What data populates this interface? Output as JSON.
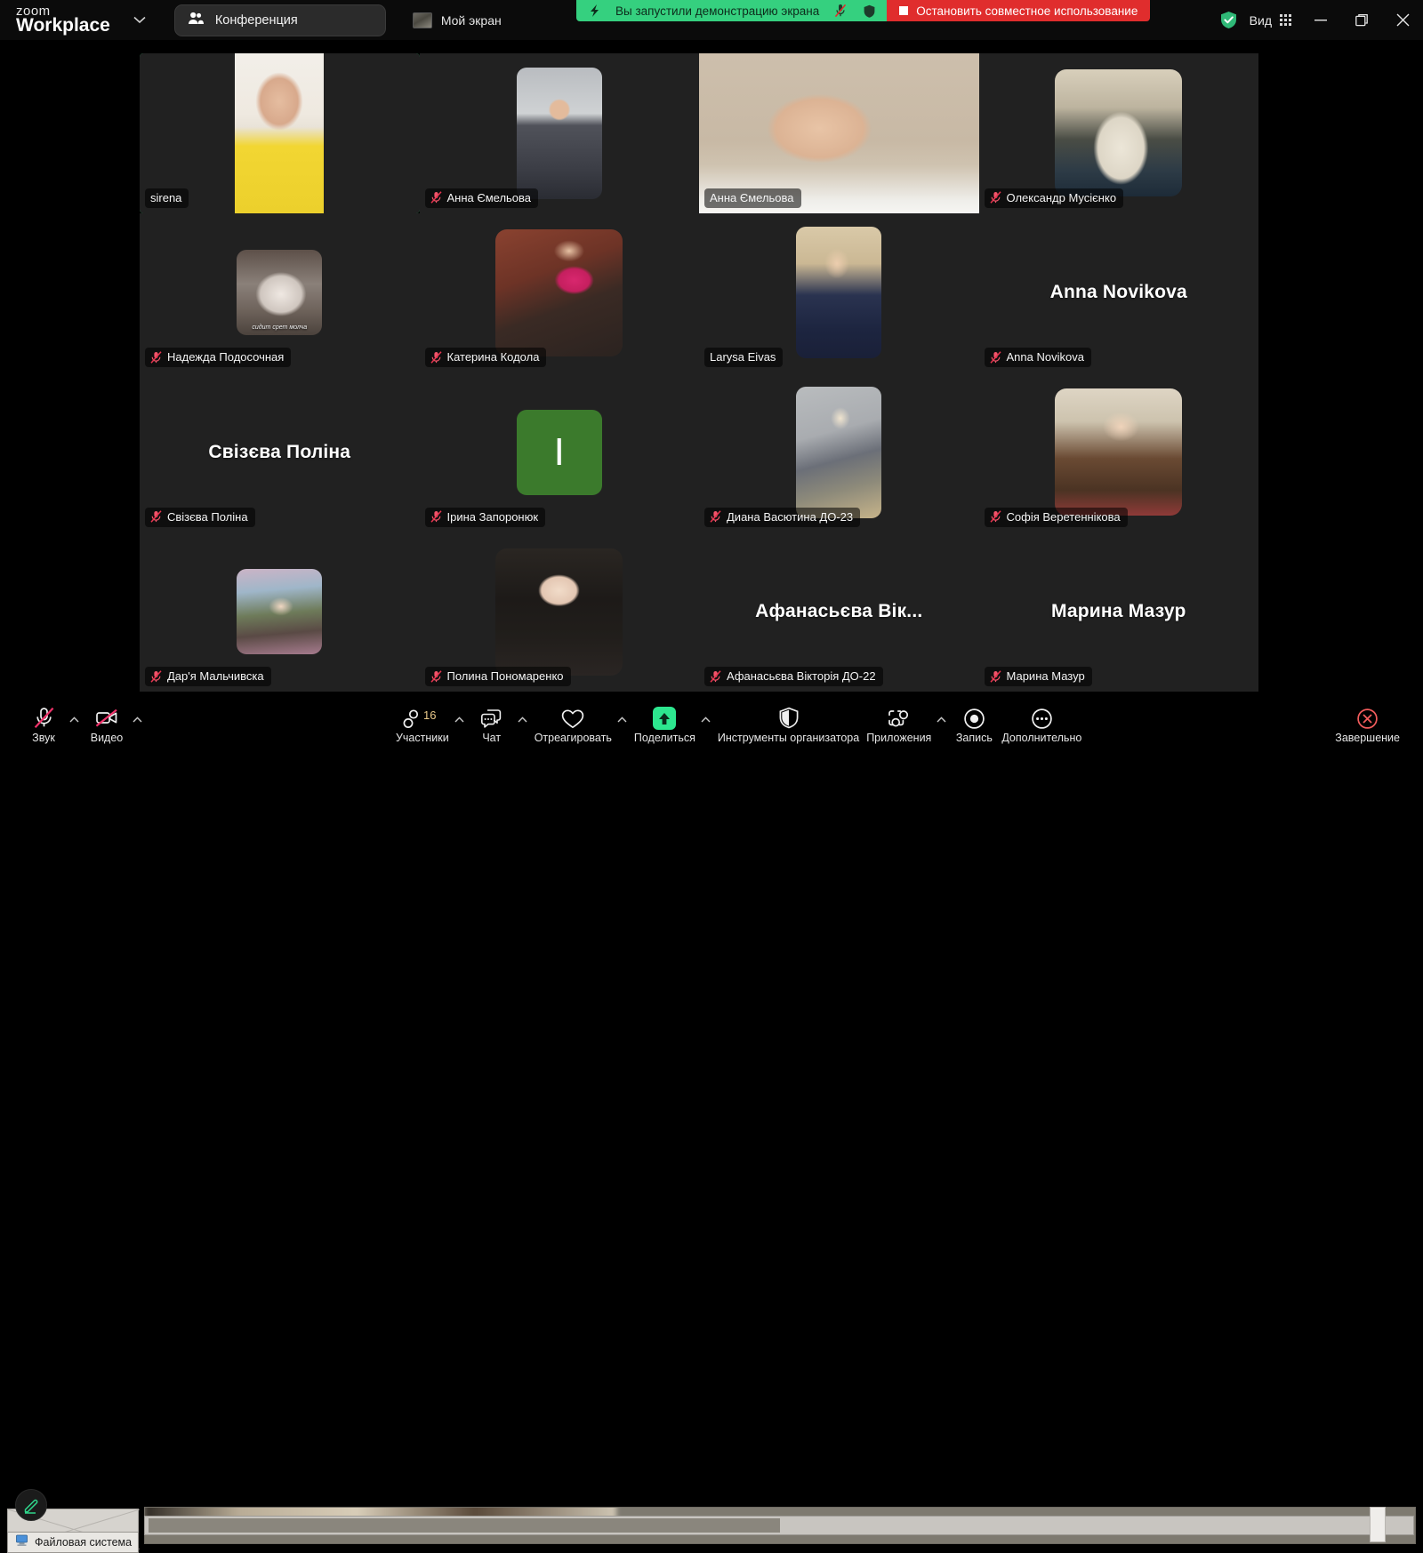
{
  "titlebar": {
    "brand_line1": "zoom",
    "brand_line2": "Workplace",
    "brand_caret_icon": "chevron-down-icon",
    "meeting_tab": {
      "label": "Конференция",
      "icon": "participants-icon"
    },
    "my_screen_tab": {
      "label": "Мой экран",
      "icon": "screen-thumbnail-icon"
    },
    "view_button": {
      "label": "Вид",
      "icon": "grid-layout-icon"
    },
    "security_icon": "shield-check-icon",
    "window_controls": {
      "minimize": "minimize-icon",
      "maximize": "restore-icon",
      "close": "close-icon"
    }
  },
  "share_banner": {
    "left_icon": "screen-share-arrow-icon",
    "message": "Вы запустили демонстрацию экрана",
    "mic_icon": "mic-muted-icon",
    "shield_icon": "shield-icon",
    "stop_button": {
      "label": "Остановить совместное использование",
      "icon": "stop-square-icon"
    },
    "green_color": "#35d07f",
    "red_color": "#e02d2d"
  },
  "grid": {
    "active_speaker_color": "#29e07a",
    "participants": [
      {
        "name": "sirena",
        "display_name": "sirena",
        "tile_type": "video",
        "muted": false,
        "active_speaker": true,
        "photo_class": "ph-sirena"
      },
      {
        "name": "Анна Ємельова",
        "display_name": "Анна Ємельова",
        "tile_type": "avatar-photo",
        "muted": true,
        "active_speaker": false,
        "photo_class": "ph-anna-th"
      },
      {
        "name": "Анна Ємельова",
        "display_name": "Анна Ємельова",
        "tile_type": "video",
        "muted": false,
        "active_speaker": false,
        "photo_class": "ph-anna-main"
      },
      {
        "name": "Олександр Мусієнко",
        "display_name": "Олександр Мусієнко",
        "tile_type": "avatar-photo",
        "muted": true,
        "active_speaker": false,
        "photo_class": "ph-oleks"
      },
      {
        "name": "Надежда Подосочная",
        "display_name": "Надежда Подосочная",
        "tile_type": "avatar-photo",
        "muted": true,
        "active_speaker": false,
        "photo_class": "ph-possum",
        "caption": "сидит срет молча"
      },
      {
        "name": "Катерина Кодола",
        "display_name": "Катерина Кодола",
        "tile_type": "avatar-photo",
        "muted": true,
        "active_speaker": false,
        "photo_class": "ph-katerina"
      },
      {
        "name": "Larysa Eivas",
        "display_name": "Larysa Eivas",
        "tile_type": "avatar-photo",
        "muted": false,
        "active_speaker": false,
        "photo_class": "ph-larysa"
      },
      {
        "name": "Anna Novikova",
        "display_name": "Anna Novikova",
        "tile_type": "name-only",
        "big_name": "Anna Novikova",
        "muted": true,
        "active_speaker": false
      },
      {
        "name": "Свізєва Поліна",
        "display_name": "Свізєва Поліна",
        "tile_type": "name-only",
        "big_name": "Свізєва Поліна",
        "muted": true,
        "active_speaker": false
      },
      {
        "name": "Ірина Запоронюк",
        "display_name": "Ірина Запоронюк",
        "tile_type": "initial",
        "initial": "I",
        "initial_bg": "#3b7a2c",
        "muted": true,
        "active_speaker": false
      },
      {
        "name": "Диана Васютина ДО-23",
        "display_name": "Диана Васютина ДО-23",
        "tile_type": "avatar-photo",
        "muted": true,
        "active_speaker": false,
        "photo_class": "ph-diana"
      },
      {
        "name": "Софія Веретеннікова",
        "display_name": "Софія Веретеннікова",
        "tile_type": "avatar-photo",
        "muted": true,
        "active_speaker": false,
        "photo_class": "ph-sofia"
      },
      {
        "name": "Дар'я Мальчивска",
        "display_name": "Дар'я Мальчивска",
        "tile_type": "avatar-photo",
        "muted": true,
        "active_speaker": false,
        "photo_class": "ph-darya"
      },
      {
        "name": "Полина Пономаренко",
        "display_name": "Полина Пономаренко",
        "tile_type": "avatar-photo",
        "muted": true,
        "active_speaker": false,
        "photo_class": "ph-polina"
      },
      {
        "name": "Афанасьєва Вікторія ДО-22",
        "display_name": "Афанасьєва Вікторія ДО-22",
        "tile_type": "name-only",
        "big_name": "Афанасьєва Вік...",
        "muted": true,
        "active_speaker": false
      },
      {
        "name": "Марина Мазур",
        "display_name": "Марина Мазур",
        "tile_type": "name-only",
        "big_name": "Марина Мазур",
        "muted": true,
        "active_speaker": false
      }
    ]
  },
  "toolbar": {
    "audio": {
      "label": "Звук",
      "icon": "mic-muted-icon",
      "has_caret": true
    },
    "video": {
      "label": "Видео",
      "icon": "camera-muted-icon",
      "has_caret": true
    },
    "participants": {
      "label": "Участники",
      "icon": "participants-icon",
      "count": "16",
      "has_caret": true
    },
    "chat": {
      "label": "Чат",
      "icon": "chat-bubble-icon",
      "has_caret": true
    },
    "react": {
      "label": "Отреагировать",
      "icon": "heart-icon",
      "has_caret": true
    },
    "share": {
      "label": "Поделиться",
      "icon": "share-up-arrow-icon",
      "has_caret": true,
      "accent": "#2de68f"
    },
    "host_tools": {
      "label": "Инструменты организатора",
      "icon": "shield-host-icon",
      "has_caret": false
    },
    "apps": {
      "label": "Приложения",
      "icon": "apps-icon",
      "has_caret": true
    },
    "record": {
      "label": "Запись",
      "icon": "record-dot-icon",
      "has_caret": false
    },
    "more": {
      "label": "Дополнительно",
      "icon": "more-dots-icon",
      "has_caret": false
    },
    "end": {
      "label": "Завершение",
      "icon": "end-call-icon",
      "color": "#f25c5c"
    }
  },
  "background": {
    "file_system_tab": {
      "label": "Файловая система",
      "icon": "computer-icon"
    },
    "annotation_badge_icon": "pencil-annotate-icon"
  }
}
